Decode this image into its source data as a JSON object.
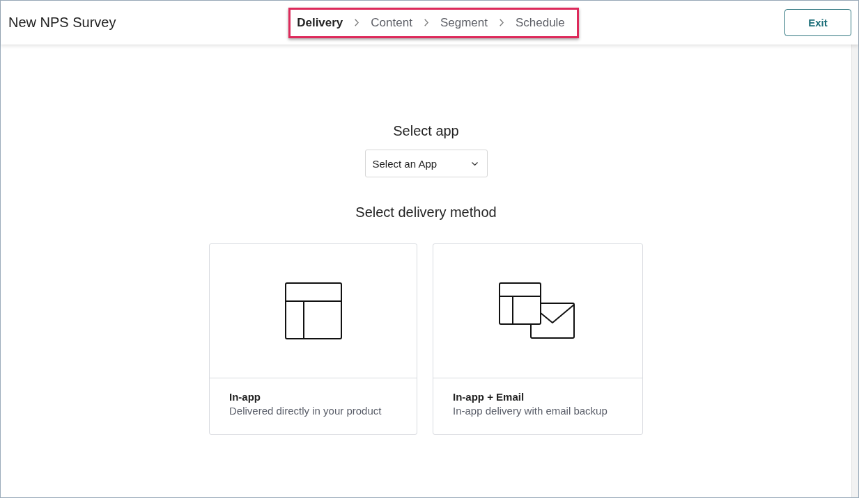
{
  "header": {
    "title": "New NPS Survey",
    "steps_highlighted": true,
    "steps": [
      {
        "label": "Delivery",
        "selected": true
      },
      {
        "label": "Content",
        "selected": false
      },
      {
        "label": "Segment",
        "selected": false
      },
      {
        "label": "Schedule",
        "selected": false
      }
    ],
    "exit_button": "Exit"
  },
  "app_section": {
    "heading": "Select app",
    "dropdown": {
      "placeholder": "Select an App"
    }
  },
  "delivery_section": {
    "heading": "Select delivery method",
    "methods": [
      {
        "kind": "in_app",
        "title": "In-app",
        "description": "Delivered directly in your product"
      },
      {
        "kind": "in_app_email",
        "title": "In-app + Email",
        "description": "In-app delivery with email backup"
      }
    ]
  }
}
